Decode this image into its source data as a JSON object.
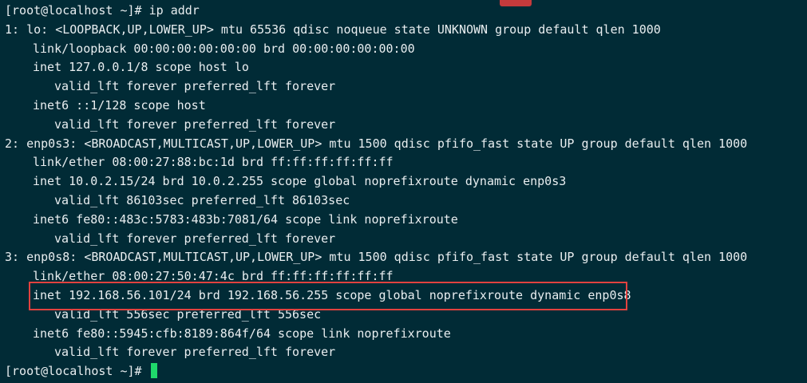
{
  "terminal": {
    "lines": [
      "[root@localhost ~]# ip addr",
      "1: lo: <LOOPBACK,UP,LOWER_UP> mtu 65536 qdisc noqueue state UNKNOWN group default qlen 1000",
      "link/loopback 00:00:00:00:00:00 brd 00:00:00:00:00:00",
      "inet 127.0.0.1/8 scope host lo",
      "valid_lft forever preferred_lft forever",
      "inet6 ::1/128 scope host",
      "valid_lft forever preferred_lft forever",
      "2: enp0s3: <BROADCAST,MULTICAST,UP,LOWER_UP> mtu 1500 qdisc pfifo_fast state UP group default qlen 1000",
      "link/ether 08:00:27:88:bc:1d brd ff:ff:ff:ff:ff:ff",
      "inet 10.0.2.15/24 brd 10.0.2.255 scope global noprefixroute dynamic enp0s3",
      "valid_lft 86103sec preferred_lft 86103sec",
      "inet6 fe80::483c:5783:483b:7081/64 scope link noprefixroute",
      "valid_lft forever preferred_lft forever",
      "3: enp0s8: <BROADCAST,MULTICAST,UP,LOWER_UP> mtu 1500 qdisc pfifo_fast state UP group default qlen 1000",
      "link/ether 08:00:27:50:47:4c brd ff:ff:ff:ff:ff:ff",
      "inet 192.168.56.101/24 brd 192.168.56.255 scope global noprefixroute dynamic enp0s8",
      "valid_lft 556sec preferred_lft 556sec",
      "inet6 fe80::5945:cfb:8189:864f/64 scope link noprefixroute",
      "valid_lft forever preferred_lft forever",
      "[root@localhost ~]# "
    ]
  },
  "colors": {
    "background": "#012b36",
    "text": "#e9eef0",
    "cursor": "#1fd86b",
    "highlight_border": "#e2423f"
  }
}
